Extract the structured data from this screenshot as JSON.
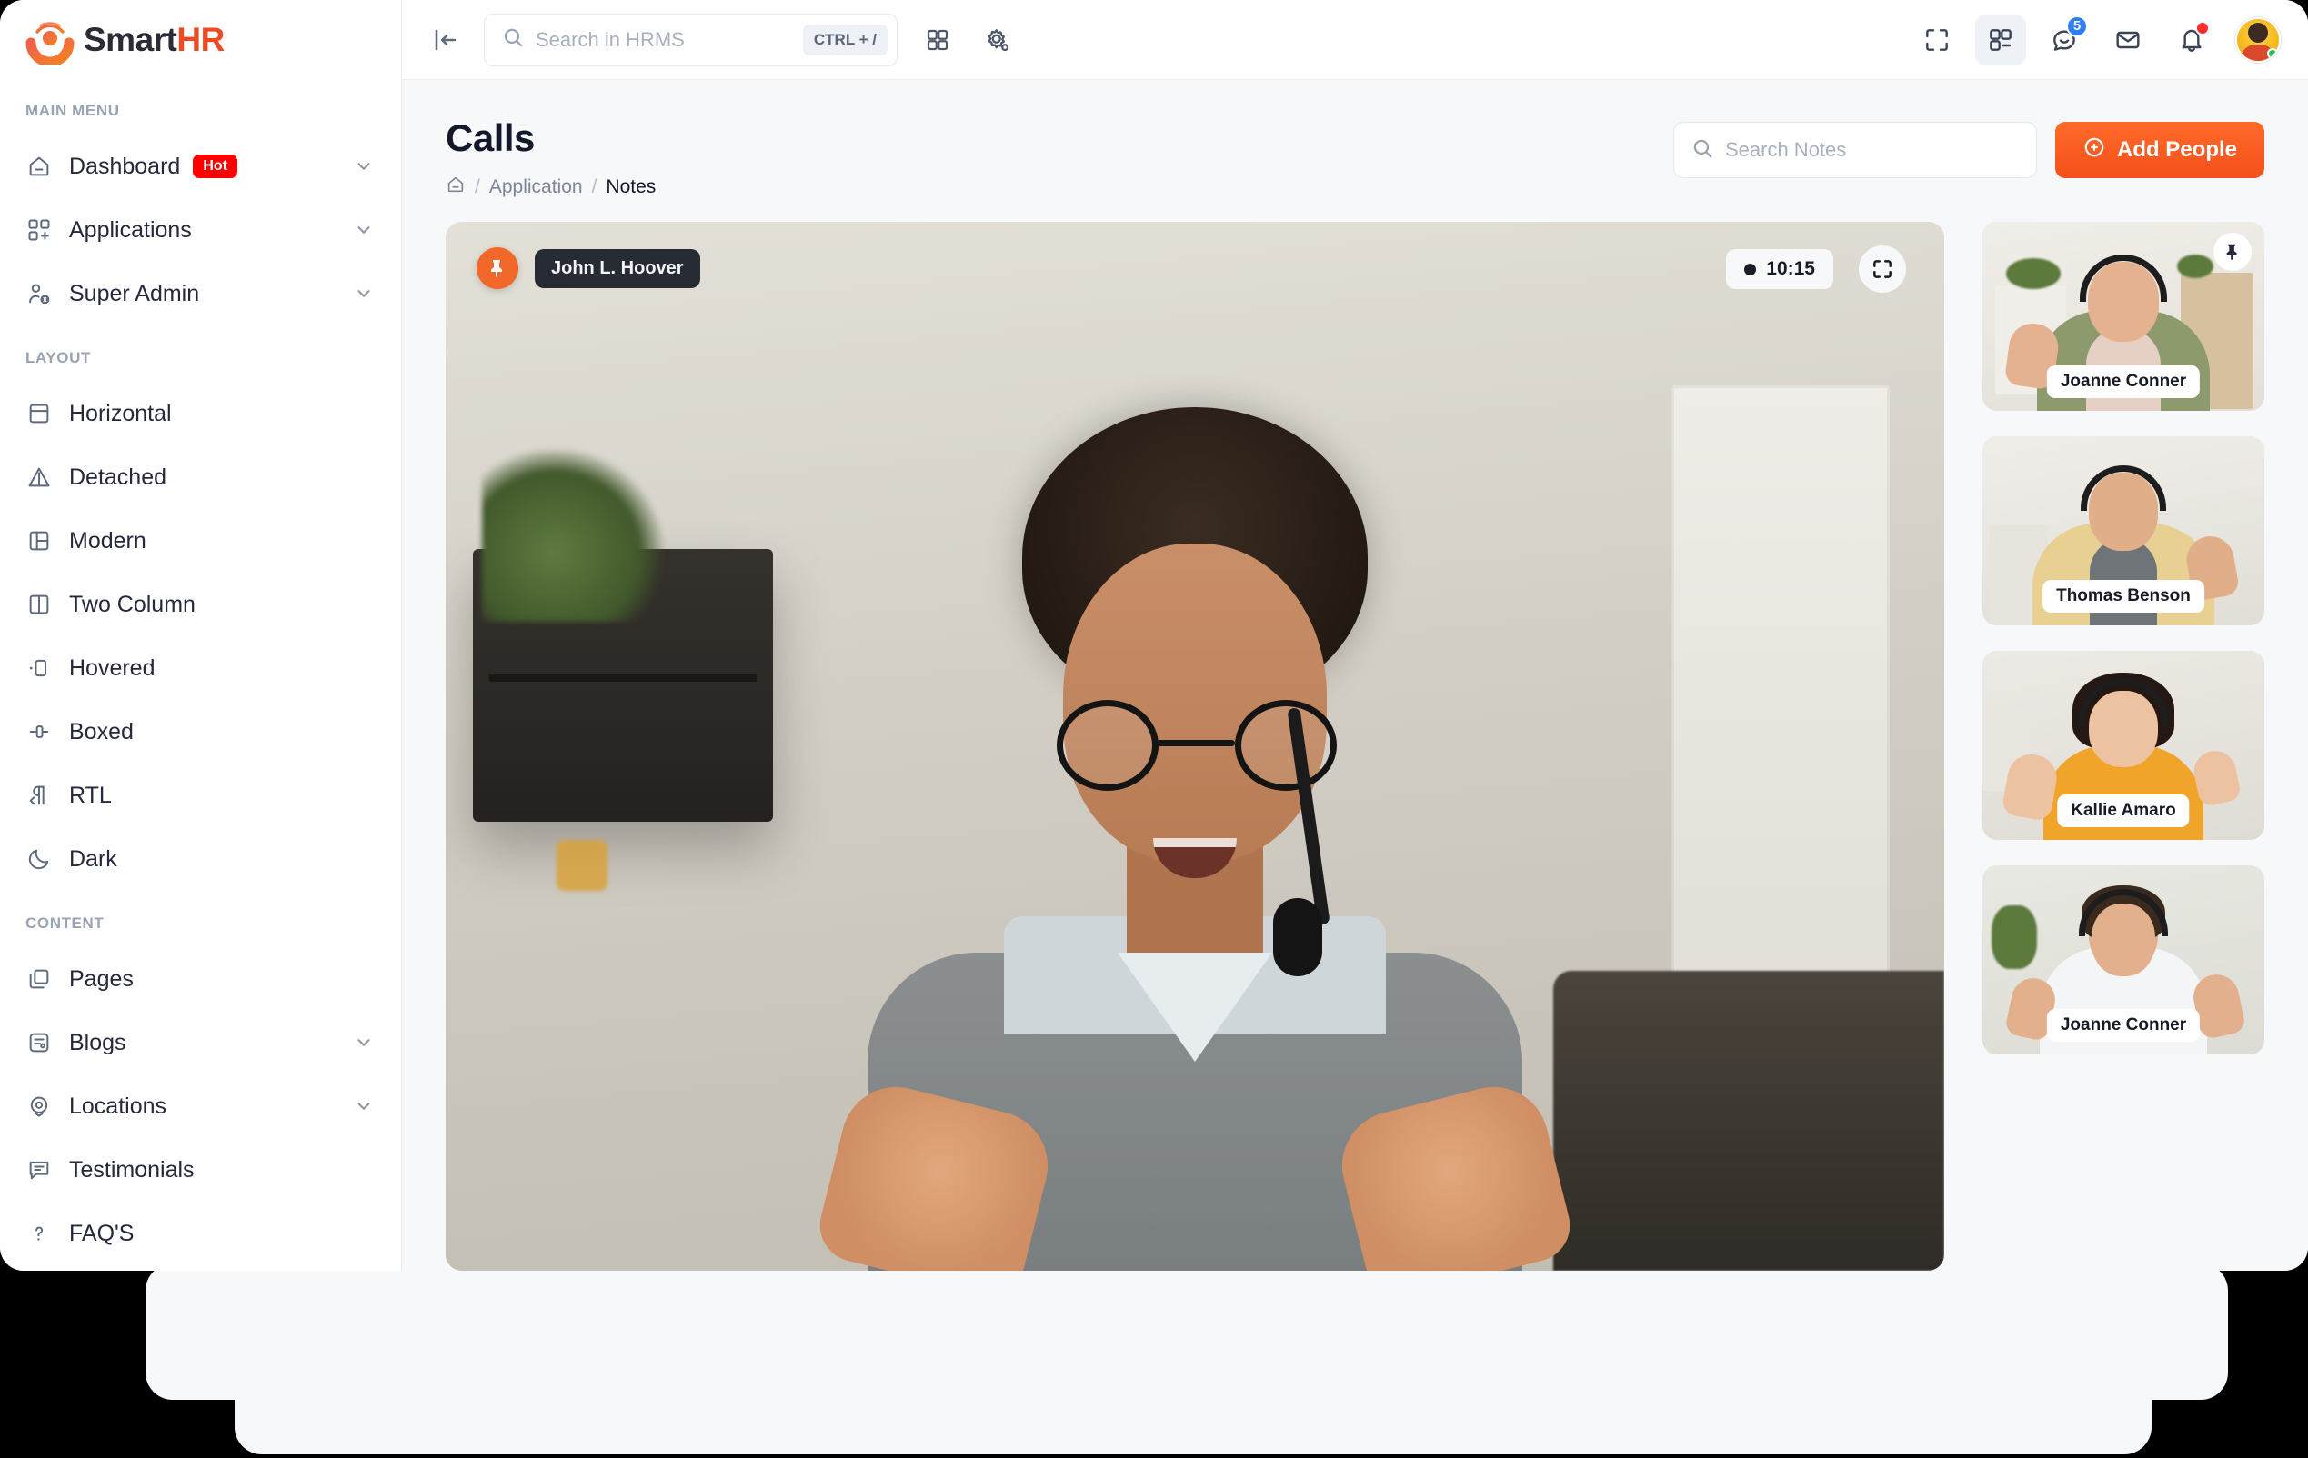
{
  "brand": {
    "name_first": "Smart",
    "name_accent": "HR",
    "logo_icon": "smarthr-logo-icon"
  },
  "sidebar": {
    "sections": [
      {
        "title": "MAIN MENU",
        "items": [
          {
            "label": "Dashboard",
            "icon": "home-icon",
            "badge": "Hot",
            "chevron": true
          },
          {
            "label": "Applications",
            "icon": "grid-apps-icon",
            "badge": null,
            "chevron": true
          },
          {
            "label": "Super Admin",
            "icon": "user-shield-icon",
            "badge": null,
            "chevron": true
          }
        ]
      },
      {
        "title": "LAYOUT",
        "items": [
          {
            "label": "Horizontal",
            "icon": "layout-horizontal-icon",
            "badge": null,
            "chevron": false
          },
          {
            "label": "Detached",
            "icon": "triangle-detached-icon",
            "badge": null,
            "chevron": false
          },
          {
            "label": "Modern",
            "icon": "layout-modern-icon",
            "badge": null,
            "chevron": false
          },
          {
            "label": "Two Column",
            "icon": "layout-two-column-icon",
            "badge": null,
            "chevron": false
          },
          {
            "label": "Hovered",
            "icon": "layout-hovered-icon",
            "badge": null,
            "chevron": false
          },
          {
            "label": "Boxed",
            "icon": "layout-boxed-icon",
            "badge": null,
            "chevron": false
          },
          {
            "label": "RTL",
            "icon": "text-direction-rtl-icon",
            "badge": null,
            "chevron": false
          },
          {
            "label": "Dark",
            "icon": "moon-icon",
            "badge": null,
            "chevron": false
          }
        ]
      },
      {
        "title": "CONTENT",
        "items": [
          {
            "label": "Pages",
            "icon": "pages-copy-icon",
            "badge": null,
            "chevron": false
          },
          {
            "label": "Blogs",
            "icon": "blog-icon",
            "badge": null,
            "chevron": true
          },
          {
            "label": "Locations",
            "icon": "map-pin-icon",
            "badge": null,
            "chevron": true
          },
          {
            "label": "Testimonials",
            "icon": "speech-bubble-icon",
            "badge": null,
            "chevron": false
          },
          {
            "label": "FAQ'S",
            "icon": "question-mark-icon",
            "badge": null,
            "chevron": false
          }
        ]
      }
    ]
  },
  "topbar": {
    "collapse_icon": "sidebar-collapse-icon",
    "search": {
      "placeholder": "Search in HRMS",
      "value": "",
      "shortcut": "CTRL + /",
      "icon": "search-icon"
    },
    "grid_icon": "apps-grid-icon",
    "settings_icon": "gear-settings-icon",
    "right_icons": [
      {
        "name": "fullscreen-icon",
        "badge": null
      },
      {
        "name": "apps-grid-button-icon",
        "badge": null
      },
      {
        "name": "chat-bubble-icon",
        "badge": "5"
      },
      {
        "name": "mail-envelope-icon",
        "badge": null
      },
      {
        "name": "bell-notification-icon",
        "badge": "dot"
      }
    ],
    "avatar": {
      "name": "profile-avatar",
      "status": "online"
    }
  },
  "page": {
    "title": "Calls",
    "breadcrumb": {
      "home_icon": "home-icon",
      "items": [
        "Application",
        "Notes"
      ],
      "separator": "/"
    },
    "notes_search": {
      "placeholder": "Search Notes",
      "value": "",
      "icon": "search-icon"
    },
    "add_people_button": {
      "label": "Add People",
      "icon": "plus-circle-icon"
    }
  },
  "call": {
    "main_speaker": {
      "name": "John L. Hoover",
      "pin_icon": "pin-icon",
      "timer": "10:15",
      "recording_dot": true,
      "fullscreen_icon": "expand-fullscreen-icon"
    },
    "participants": [
      {
        "name": "Joanne Conner",
        "pinned": true,
        "pin_icon": "pin-icon",
        "shirt": "#8d9a6e",
        "inner": "#e6cfc4",
        "skin": "#e4b290",
        "hair": "#5b3a26",
        "bg": "#eceae4"
      },
      {
        "name": "Thomas Benson",
        "pinned": false,
        "pin_icon": "pin-icon",
        "shirt": "#e8cf92",
        "inner": "#6f7478",
        "skin": "#e0ae88",
        "hair": "#5a3b24",
        "bg": "#edebe6"
      },
      {
        "name": "Kallie Amaro",
        "pinned": false,
        "pin_icon": "pin-icon",
        "shirt": "#f0a42a",
        "inner": "#f0a42a",
        "skin": "#edc2a0",
        "hair": "#241714",
        "bg": "#e9e6e1"
      },
      {
        "name": "Joanne Conner",
        "pinned": false,
        "pin_icon": "pin-icon",
        "shirt": "#f4f5f6",
        "inner": "#f4f5f6",
        "skin": "#e2b08c",
        "hair": "#3a2a1e",
        "bg": "#e6e7e2"
      }
    ]
  },
  "colors": {
    "accent": "#f5501a",
    "accent_light": "#ff6a2a",
    "badge_hot": "#ff0000",
    "badge_count": "#2f7df6",
    "badge_dot": "#ff2f2f",
    "page_bg": "#f6f8fa",
    "sidebar_bg": "#ffffff",
    "text_dark": "#13182a",
    "text_muted": "#7c8698"
  }
}
